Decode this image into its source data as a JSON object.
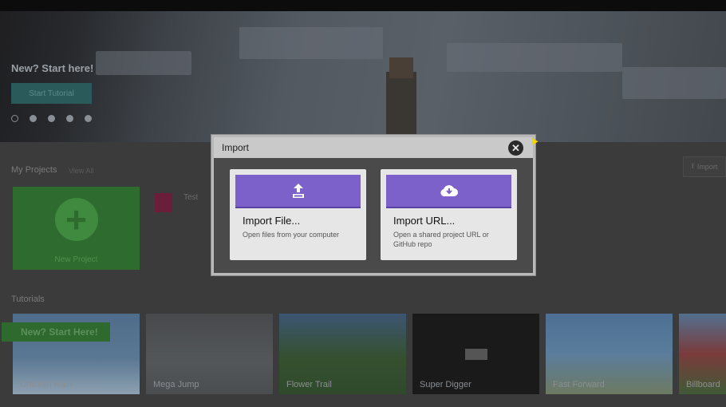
{
  "hero": {
    "title": "New? Start here!",
    "button_label": "Start Tutorial",
    "dots": [
      true,
      false,
      false,
      false,
      false
    ]
  },
  "my_projects": {
    "title": "My Projects",
    "view_all": "View All",
    "new_project_label": "New Project",
    "projects": [
      {
        "name": "Test"
      }
    ],
    "import_button_label": "Import"
  },
  "tutorials": {
    "title": "Tutorials",
    "ribbon": "New? Start Here!",
    "items": [
      {
        "label": "Chicken Rain"
      },
      {
        "label": "Mega Jump"
      },
      {
        "label": "Flower Trail"
      },
      {
        "label": "Super Digger"
      },
      {
        "label": "Fast Forward"
      },
      {
        "label": "Billboard"
      }
    ]
  },
  "modal": {
    "title": "Import",
    "close_icon": "close-icon",
    "options": [
      {
        "title": "Import File...",
        "description": "Open files from your computer",
        "icon": "upload-icon"
      },
      {
        "title": "Import URL...",
        "description": "Open a shared project URL or GitHub repo",
        "icon": "cloud-download-icon"
      }
    ]
  },
  "colors": {
    "modal_bg": "#4a4a4a",
    "header_bg": "#c9c9c9",
    "banner_purple": "#7b61c9",
    "card_bg": "#e6e6e6",
    "new_project_green": "#2e6b2e"
  }
}
